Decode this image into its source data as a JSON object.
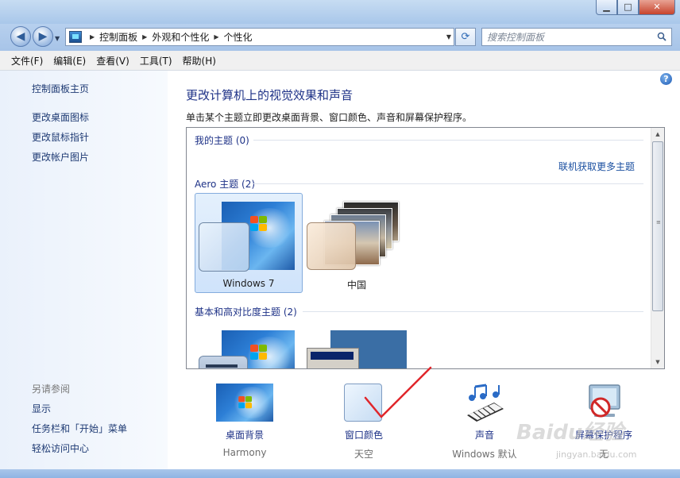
{
  "window": {
    "minimize": "▁",
    "maximize": "□",
    "close": "✕"
  },
  "nav": {
    "back": "◀",
    "forward": "▶",
    "breadcrumbs": [
      "控制面板",
      "外观和个性化",
      "个性化"
    ],
    "refresh": "⟳",
    "search_placeholder": "搜索控制面板"
  },
  "menu": [
    "文件(F)",
    "编辑(E)",
    "查看(V)",
    "工具(T)",
    "帮助(H)"
  ],
  "sidebar": {
    "home": "控制面板主页",
    "links": [
      "更改桌面图标",
      "更改鼠标指针",
      "更改帐户图片"
    ],
    "see_also_title": "另请参阅",
    "see_also": [
      "显示",
      "任务栏和「开始」菜单",
      "轻松访问中心"
    ]
  },
  "main": {
    "title": "更改计算机上的视觉效果和声音",
    "description": "单击某个主题立即更改桌面背景、窗口颜色、声音和屏幕保护程序。",
    "help": "?"
  },
  "gallery": {
    "my_themes": "我的主题 (0)",
    "get_more": "联机获取更多主题",
    "aero_themes": "Aero 主题 (2)",
    "aero": [
      {
        "name": "Windows 7",
        "selected": true
      },
      {
        "name": "中国",
        "selected": false
      }
    ],
    "basic_themes": "基本和高对比度主题 (2)"
  },
  "settings": [
    {
      "label": "桌面背景",
      "value": "Harmony"
    },
    {
      "label": "窗口颜色",
      "value": "天空"
    },
    {
      "label": "声音",
      "value": "Windows 默认"
    },
    {
      "label": "屏幕保护程序",
      "value": "无"
    }
  ],
  "watermark": {
    "text": "Baidu经验",
    "sub": "jingyan.baidu.com"
  },
  "colors": {
    "link": "#1e3287",
    "title": "#1e3287",
    "selection_border": "#84acdd",
    "annotation_red": "#e0262b"
  }
}
